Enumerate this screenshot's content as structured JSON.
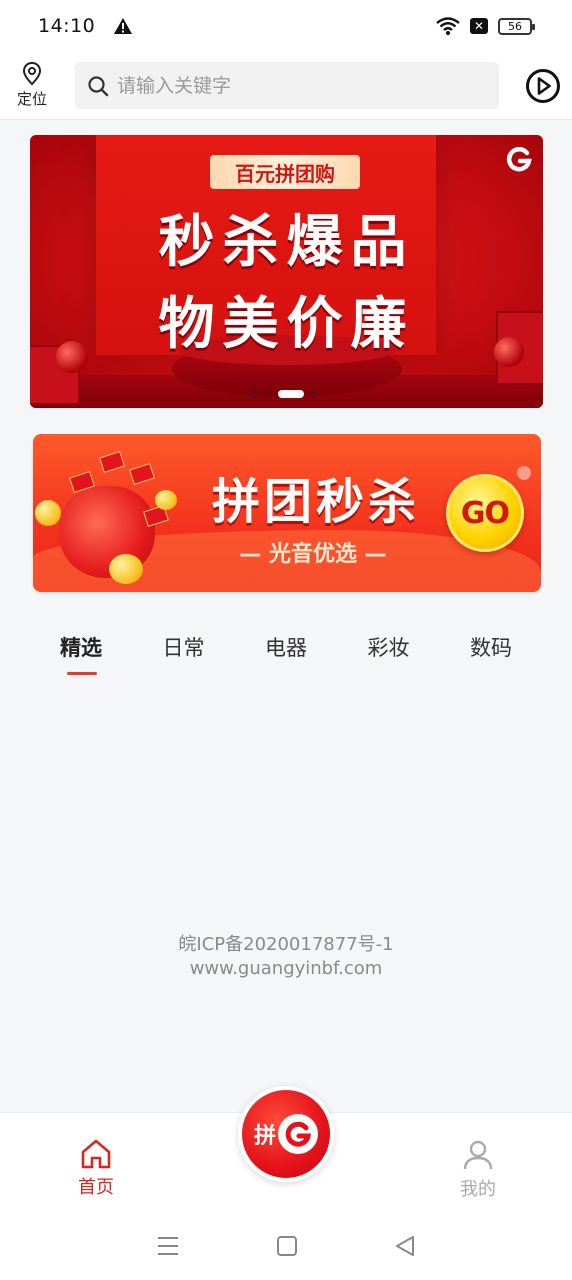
{
  "status_bar": {
    "time": "14:10",
    "battery": "56",
    "icons": [
      "warning-icon",
      "wifi-icon",
      "sim-off-icon",
      "battery-icon"
    ]
  },
  "top_nav": {
    "location_label": "定位",
    "search_placeholder": "请输入关键字",
    "search_value": ""
  },
  "banner": {
    "top_label": "百元拼团购",
    "line1": "秒杀爆品",
    "line2": "物美价廉",
    "slide_count": 4,
    "active_slide": 3
  },
  "promo": {
    "title": "拼团秒杀",
    "subtitle": "— 光音优选 —",
    "go_label": "GO"
  },
  "tabs": [
    {
      "label": "精选",
      "active": true
    },
    {
      "label": "日常",
      "active": false
    },
    {
      "label": "电器",
      "active": false
    },
    {
      "label": "彩妆",
      "active": false
    },
    {
      "label": "数码",
      "active": false
    }
  ],
  "footer": {
    "icp": "皖ICP备2020017877号-1",
    "site": "www.guangyinbf.com"
  },
  "bottom_nav": {
    "home_label": "首页",
    "center_label": "拼",
    "me_label": "我的"
  },
  "colors": {
    "accent_red": "#e4121a",
    "tab_indicator": "#e8392f",
    "home_active": "#d8261f",
    "inactive_gray": "#aaaaaa"
  }
}
